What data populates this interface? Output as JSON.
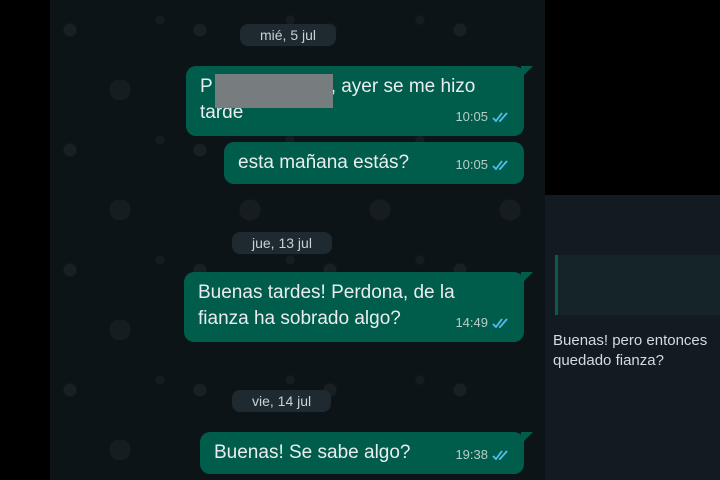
{
  "chat": {
    "dates": [
      "mié, 5 jul",
      "jue, 13 jul",
      "vie, 14 jul"
    ],
    "messages": [
      {
        "text_start": "P",
        "text_rest": ", ayer se me hizo",
        "text_line2": "tarde",
        "time": "10:05"
      },
      {
        "text": "esta mañana estás?",
        "time": "10:05"
      },
      {
        "text_line1": "Buenas tardes! Perdona, de la",
        "text_line2": "fianza ha sobrado algo?",
        "time": "14:49"
      },
      {
        "text": "Buenas! Se sabe algo?",
        "time": "19:38"
      }
    ]
  },
  "side": {
    "reply_line1": "Buenas! pero entonces",
    "reply_line2": "quedado fianza?"
  },
  "colors": {
    "bubble": "#005c4b",
    "background": "#0d1418",
    "tick_blue": "#53bdeb"
  }
}
